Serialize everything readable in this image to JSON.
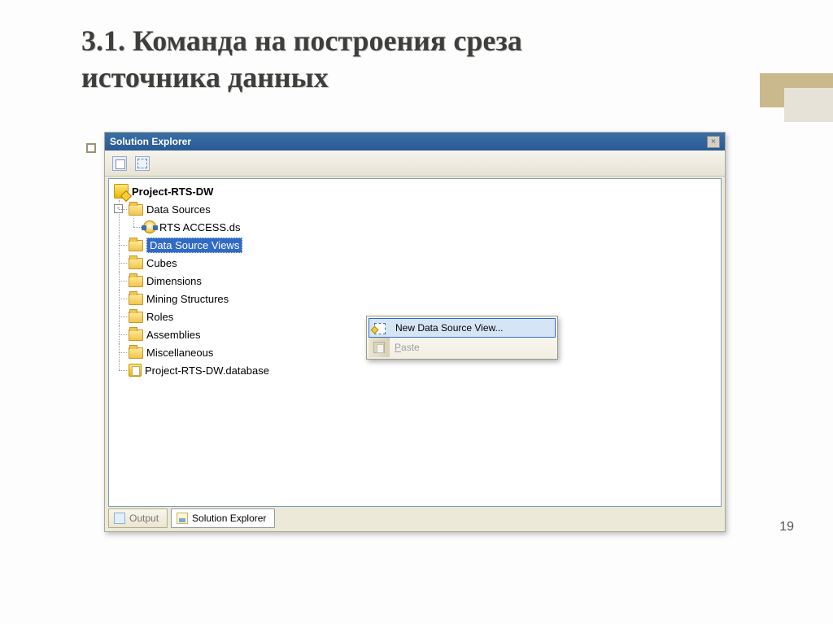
{
  "slide": {
    "title_line1": "3.1. Команда на построения среза",
    "title_line2": "источника данных",
    "page_number": "19"
  },
  "panel": {
    "title": "Solution Explorer",
    "close_glyph": "×"
  },
  "tree": {
    "project": "Project-RTS-DW",
    "data_sources": "Data Sources",
    "data_source_file": "RTS ACCESS.ds",
    "data_source_views": "Data Source Views",
    "cubes": "Cubes",
    "dimensions": "Dimensions",
    "mining": "Mining Structures",
    "roles": "Roles",
    "assemblies": "Assemblies",
    "misc": "Miscellaneous",
    "db_file": "Project-RTS-DW.database",
    "expander_minus": "-"
  },
  "context_menu": {
    "new_dsv": "New Data Source View...",
    "paste": "Paste",
    "paste_accel": "P"
  },
  "tabs": {
    "output": "Output",
    "solution_explorer": "Solution Explorer"
  }
}
